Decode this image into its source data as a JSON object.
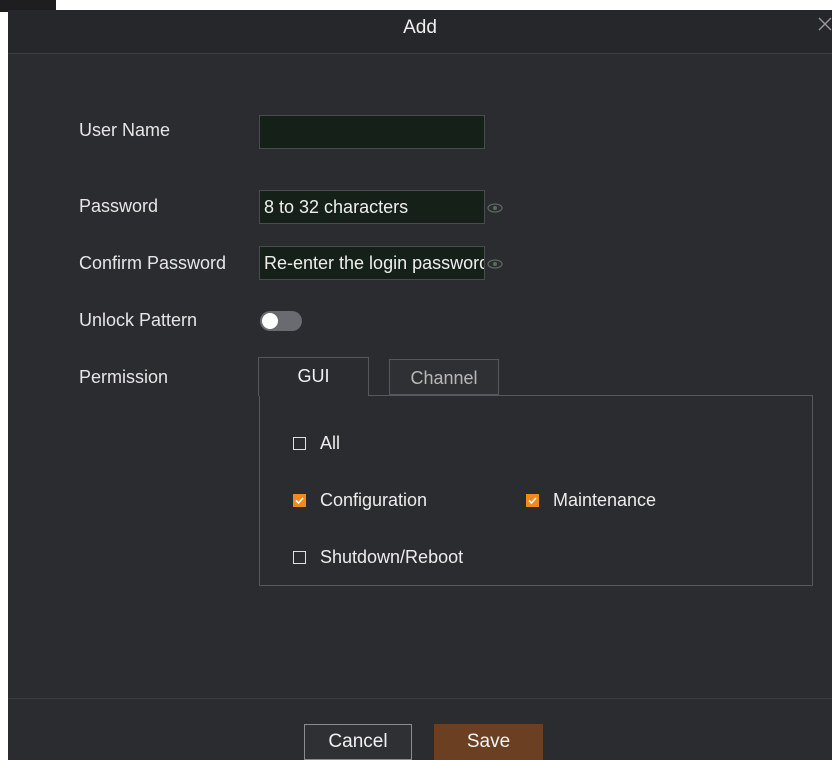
{
  "dialog": {
    "title": "Add",
    "close_icon": "close-icon"
  },
  "form": {
    "username": {
      "label": "User Name",
      "value": ""
    },
    "password": {
      "label": "Password",
      "placeholder": "8 to 32 characters",
      "icon": "eye-icon"
    },
    "confirm_password": {
      "label": "Confirm Password",
      "placeholder": "Re-enter the login password",
      "icon": "eye-icon"
    },
    "unlock_pattern": {
      "label": "Unlock Pattern",
      "enabled": false
    },
    "permission": {
      "label": "Permission",
      "tabs": [
        {
          "label": "GUI",
          "active": true
        },
        {
          "label": "Channel",
          "active": false
        }
      ],
      "options": {
        "all": {
          "label": "All",
          "checked": false
        },
        "configuration": {
          "label": "Configuration",
          "checked": true
        },
        "maintenance": {
          "label": "Maintenance",
          "checked": true
        },
        "shutdown_reboot": {
          "label": "Shutdown/Reboot",
          "checked": false
        }
      }
    }
  },
  "footer": {
    "cancel_label": "Cancel",
    "save_label": "Save"
  },
  "colors": {
    "background": "#2b2c30",
    "accent": "#ee8a1f",
    "save_button": "#6a3f22",
    "input_fill": "#152018"
  }
}
